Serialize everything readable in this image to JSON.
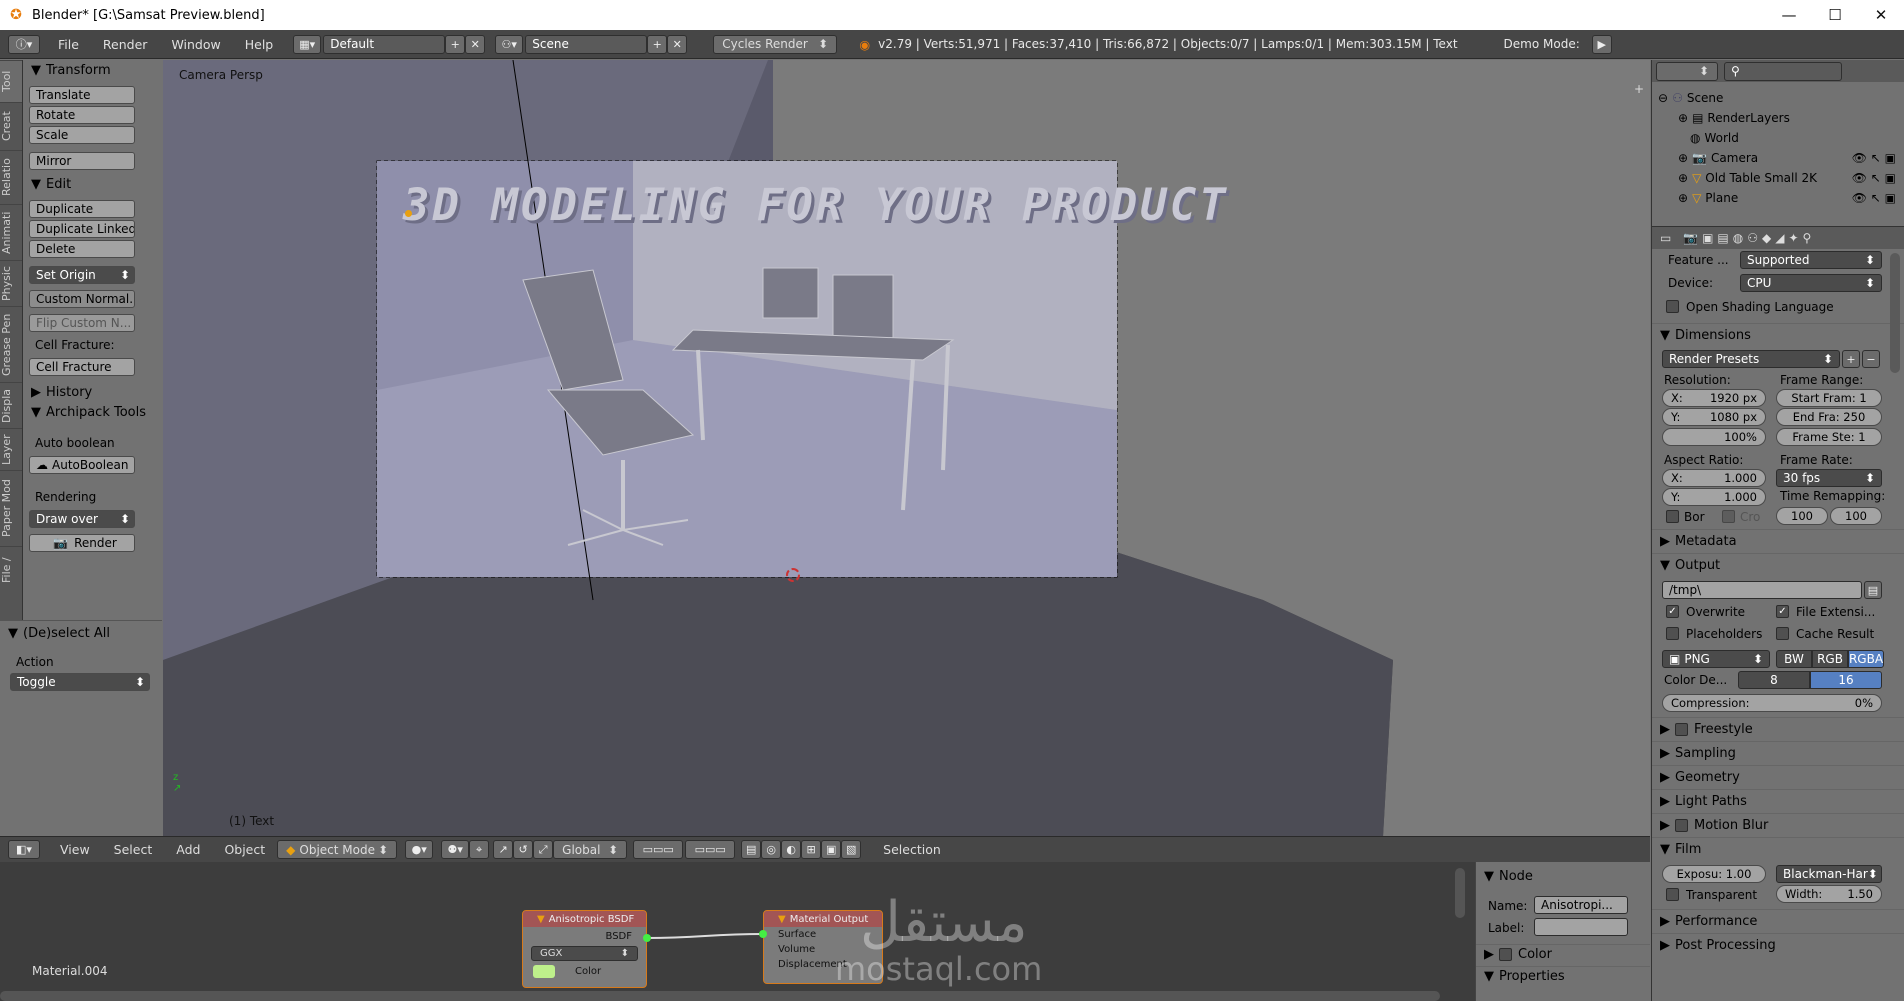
{
  "window": {
    "title": "Blender* [G:\\Samsat Preview.blend]",
    "minimize": "—",
    "maximize": "☐",
    "close": "✕"
  },
  "topbar": {
    "menus": [
      "File",
      "Render",
      "Window",
      "Help"
    ],
    "screen_layout": "Default",
    "scene": "Scene",
    "engine": "Cycles Render",
    "stats": "v2.79 | Verts:51,971 | Faces:37,410 | Tris:66,872 | Objects:0/7 | Lamps:0/1 | Mem:303.15M | Text",
    "demo_mode": "Demo Mode:"
  },
  "left_tabs": [
    "Tool",
    "Creat",
    "Relatio",
    "Animati",
    "Physic",
    "Grease Pen",
    "Displa",
    "Layer",
    "Paper Mod",
    "File /"
  ],
  "tools": {
    "transform_header": "Transform",
    "translate": "Translate",
    "rotate": "Rotate",
    "scale": "Scale",
    "mirror": "Mirror",
    "edit_header": "Edit",
    "duplicate": "Duplicate",
    "duplicate_linked": "Duplicate Linked",
    "delete": "Delete",
    "set_origin": "Set Origin",
    "custom_normal": "Custom Normal...",
    "flip_custom": "Flip Custom N...",
    "cell_fracture_label": "Cell Fracture:",
    "cell_fracture": "Cell Fracture",
    "history_header": "History",
    "archipack_header": "Archipack Tools",
    "auto_boolean_label": "Auto boolean",
    "auto_boolean": "AutoBoolean",
    "rendering_label": "Rendering",
    "draw_over": "Draw over",
    "render": "Render"
  },
  "lower_panel": {
    "header": "(De)select All",
    "action_label": "Action",
    "action_value": "Toggle"
  },
  "viewport": {
    "view_name": "Camera Persp",
    "object_name": "(1) Text",
    "title_text": "3D MODELING FOR YOUR PRODUCT"
  },
  "view_header": {
    "menus": [
      "View",
      "Select",
      "Add",
      "Object"
    ],
    "mode": "Object Mode",
    "orientation": "Global",
    "selection": "Selection"
  },
  "node_editor": {
    "material": "Material.004",
    "node1_title": "Anisotropic BSDF",
    "node1_output": "BSDF",
    "node1_dist": "GGX",
    "node1_color": "Color",
    "node2_title": "Material Output",
    "node2_inputs": [
      "Surface",
      "Volume",
      "Displacement"
    ],
    "watermark_ar": "مستقل",
    "watermark_en": "mostaql.com"
  },
  "node_panel": {
    "header": "Node",
    "name_label": "Name:",
    "name_value": "Anisotropi...",
    "label_label": "Label:",
    "color_section": "Color",
    "properties_section": "Properties"
  },
  "outliner": {
    "items": [
      {
        "name": "Scene",
        "indent": 0
      },
      {
        "name": "RenderLayers",
        "indent": 1
      },
      {
        "name": "World",
        "indent": 1
      },
      {
        "name": "Camera",
        "indent": 1
      },
      {
        "name": "Old Table Small 2K",
        "indent": 1
      },
      {
        "name": "Plane",
        "indent": 1
      }
    ]
  },
  "properties": {
    "feature_label": "Feature ...",
    "feature_value": "Supported",
    "device_label": "Device:",
    "device_value": "CPU",
    "osl": "Open Shading Language",
    "dimensions": "Dimensions",
    "render_presets": "Render Presets",
    "resolution_label": "Resolution:",
    "res_x": "1920 px",
    "res_y": "1080 px",
    "res_pct": "100%",
    "frame_range_label": "Frame Range:",
    "start_frame": "Start Fram: 1",
    "end_frame": "End Fra: 250",
    "frame_step": "Frame Ste: 1",
    "aspect_label": "Aspect Ratio:",
    "aspect_x": "1.000",
    "aspect_y": "1.000",
    "frame_rate_label": "Frame Rate:",
    "frame_rate": "30 fps",
    "time_remap_label": "Time Remapping:",
    "time_old": "100",
    "time_new": "100",
    "border": "Bor",
    "crop": "Cro",
    "metadata": "Metadata",
    "output": "Output",
    "output_path": "/tmp\\",
    "overwrite": "Overwrite",
    "file_ext": "File Extensi...",
    "placeholders": "Placeholders",
    "cache_result": "Cache Result",
    "format": "PNG",
    "bw": "BW",
    "rgb": "RGB",
    "rgba": "RGBA",
    "color_depth_label": "Color De...",
    "depth_8": "8",
    "depth_16": "16",
    "compression": "Compression:",
    "compression_value": "0%",
    "freestyle": "Freestyle",
    "sampling": "Sampling",
    "geometry": "Geometry",
    "light_paths": "Light Paths",
    "motion_blur": "Motion Blur",
    "film": "Film",
    "exposure": "Exposu: 1.00",
    "filter": "Blackman-Har",
    "transparent": "Transparent",
    "width": "Width:",
    "width_value": "1.50",
    "performance": "Performance",
    "post_processing": "Post Processing"
  }
}
